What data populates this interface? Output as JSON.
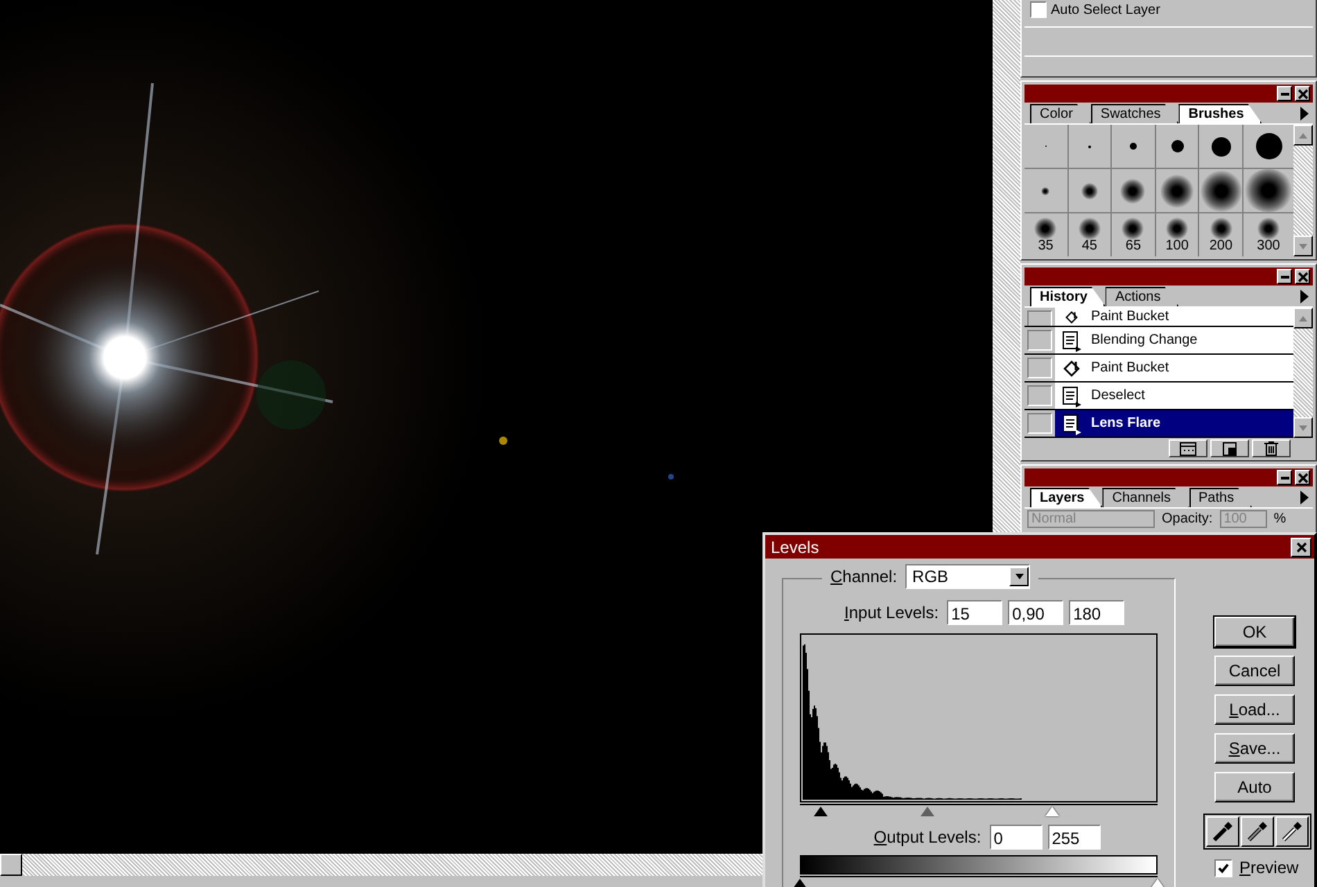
{
  "top_panel": {
    "checkbox_label": "Auto Select Layer",
    "checked": false
  },
  "brushes_panel": {
    "tabs": [
      {
        "label": "Color",
        "selected": false
      },
      {
        "label": "Swatches",
        "selected": false
      },
      {
        "label": "Brushes",
        "selected": true
      }
    ],
    "brushes": [
      {
        "kind": "hard"
      },
      {
        "kind": "hard"
      },
      {
        "kind": "hard"
      },
      {
        "kind": "hard"
      },
      {
        "kind": "hard"
      },
      {
        "kind": "hard"
      },
      {
        "kind": "soft"
      },
      {
        "kind": "soft"
      },
      {
        "kind": "soft"
      },
      {
        "kind": "soft"
      },
      {
        "kind": "soft"
      },
      {
        "kind": "soft"
      },
      {
        "kind": "soft",
        "label": "35"
      },
      {
        "kind": "soft",
        "label": "45"
      },
      {
        "kind": "soft",
        "label": "65"
      },
      {
        "kind": "soft",
        "label": "100"
      },
      {
        "kind": "soft",
        "label": "200"
      },
      {
        "kind": "soft",
        "label": "300"
      }
    ]
  },
  "history_panel": {
    "tabs": [
      {
        "label": "History",
        "selected": true
      },
      {
        "label": "Actions",
        "selected": false
      }
    ],
    "items": [
      {
        "label": "Paint Bucket",
        "kind": "bucket",
        "selected": false
      },
      {
        "label": "Blending Change",
        "kind": "document",
        "selected": false
      },
      {
        "label": "Paint Bucket",
        "kind": "bucket",
        "selected": false
      },
      {
        "label": "Deselect",
        "kind": "document",
        "selected": false
      },
      {
        "label": "Lens Flare",
        "kind": "document",
        "selected": true
      }
    ]
  },
  "layers_panel": {
    "tabs": [
      {
        "label": "Layers",
        "selected": true
      },
      {
        "label": "Channels",
        "selected": false
      },
      {
        "label": "Paths",
        "selected": false
      }
    ],
    "blend_mode": "Normal",
    "opacity_label": "Opacity:",
    "opacity": "100",
    "percent": "%",
    "disabled": true
  },
  "levels_dialog": {
    "title": "Levels",
    "channel_label": "Channel:",
    "channel": "RGB",
    "input_label": "Input Levels:",
    "input_levels": [
      "15",
      "0,90",
      "180"
    ],
    "output_label": "Output Levels:",
    "output_levels": [
      "0",
      "255"
    ],
    "buttons": [
      "OK",
      "Cancel",
      "Load...",
      "Save...",
      "Auto"
    ],
    "preview_label": "Preview",
    "preview_checked": true
  }
}
